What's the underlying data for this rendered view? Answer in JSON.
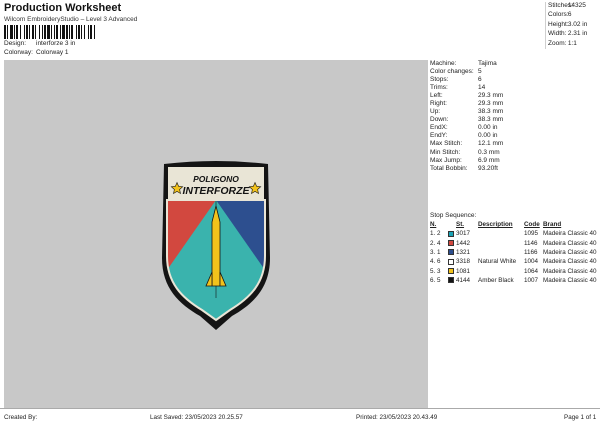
{
  "header": {
    "title": "Production Worksheet",
    "subtitle": "Wilcom EmbroideryStudio – Level 3 Advanced",
    "design_label": "Design:",
    "design_value": "interforze 3 in",
    "colorway_label": "Colorway:",
    "colorway_value": "Colorway 1"
  },
  "stats": [
    {
      "label": "Stitches:",
      "value": "14325"
    },
    {
      "label": "Colors:",
      "value": "6"
    },
    {
      "label": "Height:",
      "value": "3.02 in"
    },
    {
      "label": "Width:",
      "value": "2.31 in"
    },
    {
      "label": "Zoom:",
      "value": "1:1"
    }
  ],
  "patch": {
    "line1": "POLIGONO",
    "line2": "INTERFORZE",
    "colors": {
      "red": "#d2483f",
      "blue": "#2d4f8f",
      "teal": "#3ab3ad",
      "yellow": "#f2c21b",
      "cream": "#e9e5d6",
      "black": "#141414",
      "canvas": "#c8c8c8"
    }
  },
  "info": [
    {
      "label": "Machine:",
      "value": "Tajima"
    },
    {
      "label": "Color changes:",
      "value": "5"
    },
    {
      "label": "Stops:",
      "value": "6"
    },
    {
      "label": "Trims:",
      "value": "14"
    },
    {
      "label": "Left:",
      "value": "29.3 mm"
    },
    {
      "label": "Right:",
      "value": "29.3 mm"
    },
    {
      "label": "Up:",
      "value": "38.3 mm"
    },
    {
      "label": "Down:",
      "value": "38.3 mm"
    },
    {
      "label": "EndX:",
      "value": "0.00 in"
    },
    {
      "label": "EndY:",
      "value": "0.00 in"
    },
    {
      "label": "Max Stitch:",
      "value": "12.1 mm"
    },
    {
      "label": "Min Stitch:",
      "value": "0.3 mm"
    },
    {
      "label": "Max Jump:",
      "value": "6.9 mm"
    },
    {
      "label": "Total Bobbin:",
      "value": "93.20ft"
    }
  ],
  "sequence": {
    "title": "Stop Sequence:",
    "headers": [
      "N.",
      "St.",
      "Description",
      "Code",
      "Brand"
    ],
    "rows": [
      {
        "seq": "1.",
        "n": "2",
        "color": "#1aa3b5",
        "st": "3017",
        "desc": "",
        "code": "1095",
        "brand": "Madeira Classic 40"
      },
      {
        "seq": "2.",
        "n": "4",
        "color": "#d2483f",
        "st": "1442",
        "desc": "",
        "code": "1146",
        "brand": "Madeira Classic 40"
      },
      {
        "seq": "3.",
        "n": "1",
        "color": "#2d4f8f",
        "st": "1321",
        "desc": "",
        "code": "1166",
        "brand": "Madeira Classic 40"
      },
      {
        "seq": "4.",
        "n": "6",
        "color": "#ffffff",
        "st": "3318",
        "desc": "Natural White",
        "code": "1004",
        "brand": "Madeira Classic 40"
      },
      {
        "seq": "5.",
        "n": "3",
        "color": "#f2c21b",
        "st": "1081",
        "desc": "",
        "code": "1064",
        "brand": "Madeira Classic 40"
      },
      {
        "seq": "6.",
        "n": "5",
        "color": "#141414",
        "st": "4144",
        "desc": "Amber Black",
        "code": "1007",
        "brand": "Madeira Classic 40"
      }
    ]
  },
  "footer": {
    "created": "Created By:",
    "saved": "Last Saved: 23/05/2023 20.25.57",
    "printed": "Printed: 23/05/2023 20.43.49",
    "page": "Page 1 of 1"
  }
}
